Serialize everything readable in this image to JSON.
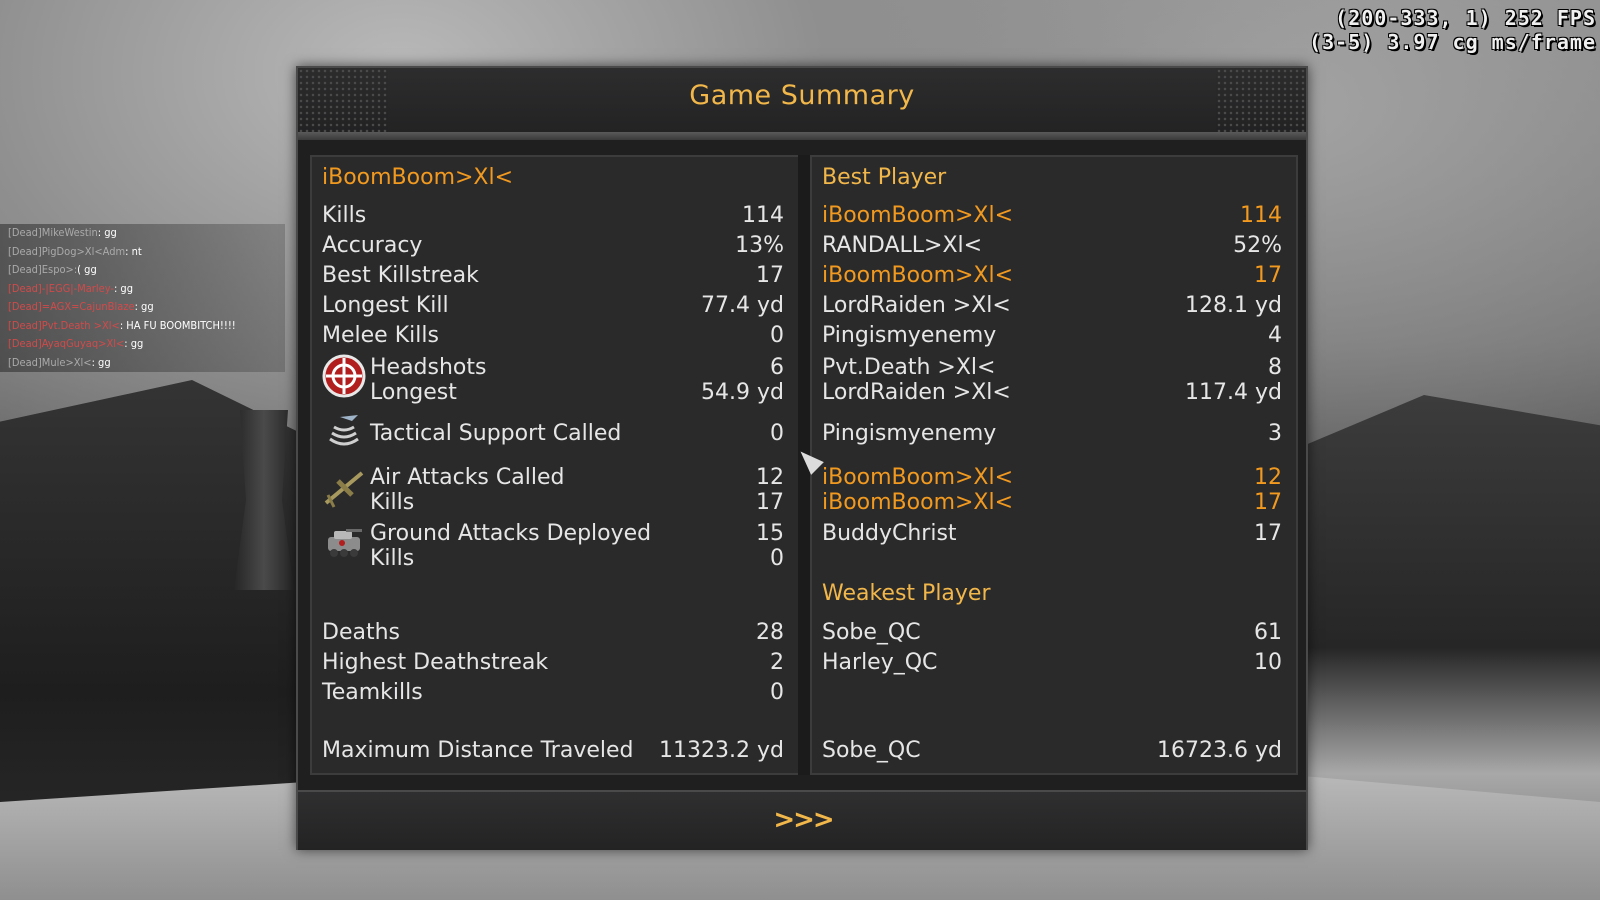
{
  "debug": {
    "line1": "(200-333, 1) 252 FPS",
    "line2": "(3-5) 3.97 cg ms/frame"
  },
  "chat": [
    {
      "who": "[Dead]MikeWestin",
      "msg": ": gg",
      "red": false
    },
    {
      "who": "[Dead]PigDog>Xl<Adm",
      "msg": ": nt",
      "red": false
    },
    {
      "who": "[Dead]Espo>:",
      "msg": "( gg",
      "red": false
    },
    {
      "who": "[Dead]-|EGG|-Marley-",
      "msg": ": gg",
      "red": true
    },
    {
      "who": "[Dead]=AGX=CajunBlaze",
      "msg": ": gg",
      "red": true
    },
    {
      "who": "[Dead]Pvt.Death >Xl<",
      "msg": ": HA FU BOOMBITCH!!!!",
      "red": true
    },
    {
      "who": "[Dead]AyaqGuyaq>Xl<",
      "msg": ": gg",
      "red": true
    },
    {
      "who": "[Dead]Mule>Xl<",
      "msg": ": gg",
      "red": false
    }
  ],
  "title": "Game Summary",
  "left": {
    "player": "iBoomBoom>Xl<",
    "kills": {
      "label": "Kills",
      "value": "114"
    },
    "accuracy": {
      "label": "Accuracy",
      "value": "13%"
    },
    "best_killstreak": {
      "label": "Best Killstreak",
      "value": "17"
    },
    "longest_kill": {
      "label": "Longest Kill",
      "value": "77.4 yd"
    },
    "melee_kills": {
      "label": "Melee Kills",
      "value": "0"
    },
    "headshots": {
      "label": "Headshots",
      "value": "6"
    },
    "headshots_longest": {
      "label": "Longest",
      "value": "54.9 yd"
    },
    "tactical": {
      "label": "Tactical Support Called",
      "value": "0"
    },
    "air_attacks": {
      "label": "Air Attacks Called",
      "value": "12"
    },
    "air_kills": {
      "label": "Kills",
      "value": "17"
    },
    "ground_attacks": {
      "label": "Ground Attacks Deployed",
      "value": "15"
    },
    "ground_kills": {
      "label": "Kills",
      "value": "0"
    },
    "deaths": {
      "label": "Deaths",
      "value": "28"
    },
    "deathstreak": {
      "label": "Highest Deathstreak",
      "value": "2"
    },
    "teamkills": {
      "label": "Teamkills",
      "value": "0"
    },
    "distance": {
      "label": "Maximum Distance Traveled",
      "value": "11323.2 yd"
    }
  },
  "right": {
    "best_header": "Best Player",
    "best": [
      {
        "name": "iBoomBoom>Xl<",
        "value": "114",
        "highlight": true
      },
      {
        "name": "RANDALL>Xl<",
        "value": "52%",
        "highlight": false
      },
      {
        "name": "iBoomBoom>Xl<",
        "value": "17",
        "highlight": true
      },
      {
        "name": "LordRaiden >Xl<",
        "value": "128.1 yd",
        "highlight": false
      },
      {
        "name": "Pingismyenemy",
        "value": "4",
        "highlight": false
      },
      {
        "name": "Pvt.Death >Xl<",
        "value": "8",
        "highlight": false
      },
      {
        "name": "LordRaiden >Xl<",
        "value": "117.4 yd",
        "highlight": false
      },
      {
        "name": "Pingismyenemy",
        "value": "3",
        "highlight": false
      },
      {
        "name": "iBoomBoom>Xl<",
        "value": "12",
        "highlight": true
      },
      {
        "name": "iBoomBoom>Xl<",
        "value": "17",
        "highlight": true
      },
      {
        "name": "BuddyChrist",
        "value": "17",
        "highlight": false
      }
    ],
    "weakest_header": "Weakest Player",
    "weakest": [
      {
        "name": "Sobe_QC",
        "value": "61"
      },
      {
        "name": "Harley_QC",
        "value": "10"
      }
    ],
    "distance": {
      "name": "Sobe_QC",
      "value": "16723.6 yd"
    }
  },
  "footer": {
    "next_label": ">>>"
  },
  "colors": {
    "accent": "#f2b74a",
    "highlight": "#f29a1f",
    "text": "#e6e6e6",
    "panel": "#2a2a2b"
  }
}
